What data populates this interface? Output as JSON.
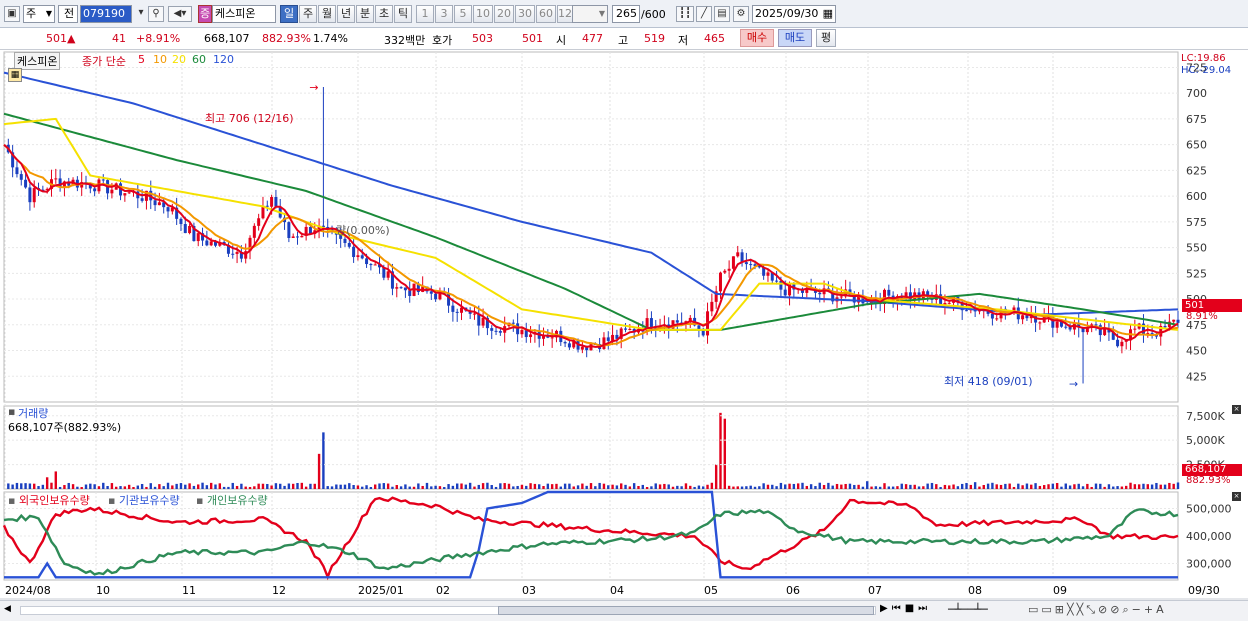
{
  "toolbar": {
    "market": "주",
    "scope": "전",
    "code": "079190",
    "stock_name": "케스피온",
    "name_badge": "증",
    "periods": [
      "일",
      "주",
      "월",
      "년",
      "분",
      "초",
      "틱"
    ],
    "active_period": "일",
    "intervals": [
      "1",
      "3",
      "5",
      "10",
      "20",
      "30",
      "60",
      "120"
    ],
    "count_value": "265",
    "count_total": "/600",
    "date": "2025/09/30"
  },
  "quote": {
    "price": "501",
    "arrow": "▲",
    "change": "41",
    "change_pct": "+8.91%",
    "volume": "668,107",
    "volume_pct": "882.93%",
    "turnover": "1.74%",
    "amount": "332백만",
    "bid_label": "호가",
    "ask": "503",
    "bid": "501",
    "open_label": "시",
    "open": "477",
    "high_label": "고",
    "high": "519",
    "low_label": "저",
    "low": "465",
    "buy_label": "매수",
    "sell_label": "매도",
    "avg_label": "평"
  },
  "colors": {
    "up": "#e3001b",
    "down": "#1a3fbf",
    "ma5": "#e3001b",
    "ma10": "#f39800",
    "ma20": "#f5e100",
    "ma60": "#1b8a3a",
    "ma120": "#2a52d6",
    "foreign": "#e3001b",
    "inst": "#2a52d6",
    "retail": "#2e8b57"
  },
  "price_panel": {
    "title": "케스피온",
    "ma_prefix": "종가 단순",
    "ma_periods": [
      "5",
      "10",
      "20",
      "60",
      "120"
    ],
    "lc": "LC:19.86",
    "hc": "HC:-29.04",
    "high_note": "최고 706 (12/16)",
    "low_note": "최저 418 (09/01)",
    "mid_note": "량(0.00%)",
    "current_price": "501",
    "current_pct": "8.91%"
  },
  "volume_panel": {
    "title": "거래량",
    "value_note": "668,107주(882.93%)",
    "current": "668,107",
    "current_pct": "882.93%"
  },
  "holding_panel": {
    "series_names": [
      "외국인보유수량",
      "기관보유수량",
      "개인보유수량"
    ]
  },
  "x_labels": [
    "2024/08",
    "10",
    "11",
    "12",
    "2025/01",
    "02",
    "03",
    "04",
    "05",
    "06",
    "07",
    "08",
    "09"
  ],
  "x_right_label": "09/30",
  "chart_data": [
    {
      "type": "line",
      "name": "price",
      "ylim": [
        400,
        740
      ],
      "yticks": [
        425,
        450,
        475,
        500,
        525,
        550,
        575,
        600,
        625,
        650,
        675,
        700,
        725
      ],
      "anchors": [
        [
          0,
          650
        ],
        [
          6,
          600
        ],
        [
          12,
          615
        ],
        [
          20,
          612
        ],
        [
          32,
          600
        ],
        [
          38,
          590
        ],
        [
          44,
          560
        ],
        [
          55,
          545
        ],
        [
          62,
          600
        ],
        [
          66,
          560
        ],
        [
          72,
          570
        ],
        [
          82,
          545
        ],
        [
          92,
          510
        ],
        [
          100,
          505
        ],
        [
          110,
          478
        ],
        [
          120,
          470
        ],
        [
          128,
          465
        ],
        [
          134,
          455
        ],
        [
          140,
          460
        ],
        [
          150,
          478
        ],
        [
          158,
          478
        ],
        [
          162,
          470
        ],
        [
          166,
          520
        ],
        [
          170,
          540
        ],
        [
          180,
          510
        ],
        [
          190,
          505
        ],
        [
          200,
          500
        ],
        [
          208,
          505
        ],
        [
          216,
          500
        ],
        [
          222,
          495
        ],
        [
          228,
          488
        ],
        [
          238,
          485
        ],
        [
          246,
          475
        ],
        [
          252,
          470
        ],
        [
          258,
          460
        ],
        [
          262,
          470
        ],
        [
          268,
          468
        ],
        [
          272,
          480
        ]
      ],
      "high": {
        "value": 706,
        "index": 74
      },
      "low": {
        "value": 418,
        "index": 250
      }
    },
    {
      "type": "line",
      "name": "moving-averages",
      "series": [
        {
          "name": "120",
          "values_anchor": [
            [
              0,
              720
            ],
            [
              30,
              690
            ],
            [
              60,
              650
            ],
            [
              90,
              610
            ],
            [
              120,
              575
            ],
            [
              150,
              545
            ],
            [
              165,
              505
            ],
            [
              200,
              498
            ],
            [
              240,
              485
            ],
            [
              272,
              490
            ]
          ]
        },
        {
          "name": "60",
          "values_anchor": [
            [
              0,
              680
            ],
            [
              40,
              635
            ],
            [
              70,
              605
            ],
            [
              100,
              560
            ],
            [
              130,
              510
            ],
            [
              150,
              470
            ],
            [
              166,
              470
            ],
            [
              200,
              495
            ],
            [
              226,
              505
            ],
            [
              250,
              490
            ],
            [
              272,
              475
            ]
          ]
        },
        {
          "name": "20",
          "values_anchor": [
            [
              0,
              670
            ],
            [
              12,
              675
            ],
            [
              20,
              620
            ],
            [
              60,
              590
            ],
            [
              80,
              560
            ],
            [
              100,
              540
            ],
            [
              120,
              490
            ],
            [
              150,
              470
            ],
            [
              166,
              470
            ],
            [
              175,
              515
            ],
            [
              190,
              515
            ],
            [
              200,
              500
            ],
            [
              230,
              490
            ],
            [
              272,
              470
            ]
          ]
        }
      ]
    },
    {
      "type": "bar",
      "name": "volume",
      "yticks_labels": [
        "2,500K",
        "5,000K",
        "7,500K"
      ],
      "ylim": [
        0,
        8500
      ],
      "spikes": [
        [
          12,
          1800
        ],
        [
          10,
          1200
        ],
        [
          74,
          5800
        ],
        [
          73,
          3600
        ],
        [
          166,
          7800
        ],
        [
          167,
          7200
        ],
        [
          165,
          2500
        ],
        [
          200,
          800
        ],
        [
          225,
          700
        ],
        [
          272,
          668
        ]
      ]
    },
    {
      "type": "line",
      "name": "holdings",
      "ylim": [
        240000,
        560000
      ],
      "yticks": [
        300000,
        400000,
        500000
      ],
      "series": [
        {
          "name": "외국인보유수량",
          "anchor": [
            [
              0,
              430
            ],
            [
              6,
              300
            ],
            [
              12,
              480
            ],
            [
              20,
              500
            ],
            [
              40,
              450
            ],
            [
              60,
              460
            ],
            [
              70,
              380
            ],
            [
              75,
              260
            ],
            [
              86,
              540
            ],
            [
              100,
              510
            ],
            [
              110,
              460
            ],
            [
              140,
              420
            ],
            [
              160,
              400
            ],
            [
              166,
              310
            ],
            [
              172,
              280
            ],
            [
              190,
              420
            ],
            [
              196,
              530
            ],
            [
              210,
              510
            ],
            [
              216,
              440
            ],
            [
              250,
              460
            ],
            [
              256,
              400
            ],
            [
              272,
              395
            ]
          ]
        },
        {
          "name": "기관보유수량",
          "anchor": [
            [
              0,
              250
            ],
            [
              8,
              250
            ],
            [
              10,
              300
            ],
            [
              12,
              250
            ],
            [
              108,
              250
            ],
            [
              110,
              350
            ],
            [
              112,
              500
            ],
            [
              120,
              520
            ],
            [
              126,
              560
            ],
            [
              160,
              560
            ],
            [
              164,
              560
            ],
            [
              166,
              250
            ],
            [
              272,
              250
            ]
          ]
        },
        {
          "name": "개인보유수량",
          "anchor": [
            [
              0,
              460
            ],
            [
              8,
              470
            ],
            [
              14,
              300
            ],
            [
              22,
              260
            ],
            [
              40,
              340
            ],
            [
              60,
              340
            ],
            [
              70,
              380
            ],
            [
              80,
              340
            ],
            [
              88,
              280
            ],
            [
              106,
              330
            ],
            [
              124,
              370
            ],
            [
              150,
              390
            ],
            [
              160,
              410
            ],
            [
              166,
              480
            ],
            [
              176,
              490
            ],
            [
              184,
              420
            ],
            [
              196,
              380
            ],
            [
              240,
              380
            ],
            [
              256,
              400
            ],
            [
              262,
              490
            ],
            [
              272,
              480
            ]
          ]
        }
      ]
    }
  ]
}
